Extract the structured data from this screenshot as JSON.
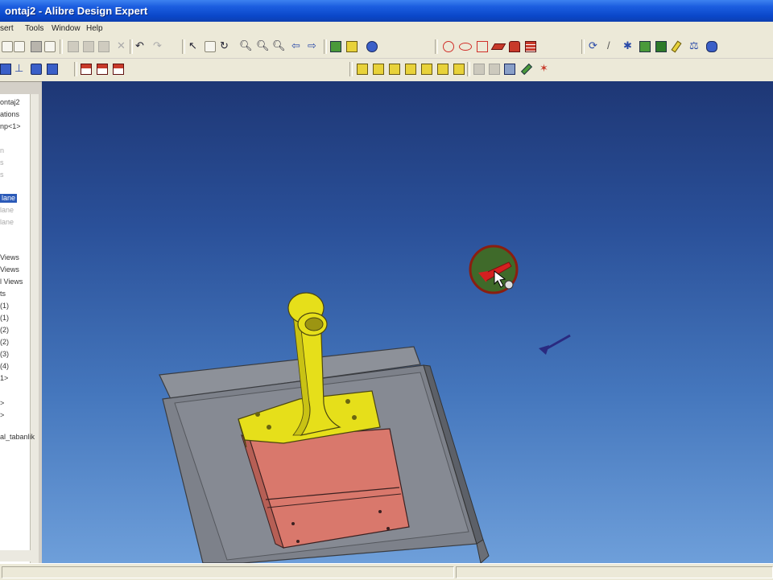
{
  "window": {
    "title": "ontaj2 - Alibre Design Expert"
  },
  "menu": {
    "items": [
      "sert",
      "Tools",
      "Window",
      "Help"
    ]
  },
  "tree": {
    "items": [
      {
        "label": "ontaj2",
        "style": "normal"
      },
      {
        "label": "ations",
        "style": "normal"
      },
      {
        "label": "np<1>",
        "style": "normal"
      },
      {
        "label": "n",
        "style": "faded"
      },
      {
        "label": "s",
        "style": "faded"
      },
      {
        "label": "s",
        "style": "faded"
      },
      {
        "label": "lane",
        "style": "sel"
      },
      {
        "label": "lane",
        "style": "faded"
      },
      {
        "label": "lane",
        "style": "faded"
      },
      {
        "label": "Views",
        "style": "normal"
      },
      {
        "label": "Views",
        "style": "normal"
      },
      {
        "label": "l Views",
        "style": "normal"
      },
      {
        "label": "ts",
        "style": "normal"
      },
      {
        "label": "(1)",
        "style": "normal"
      },
      {
        "label": "(1)",
        "style": "normal"
      },
      {
        "label": "(2)",
        "style": "normal"
      },
      {
        "label": "(2)",
        "style": "normal"
      },
      {
        "label": "(3)",
        "style": "normal"
      },
      {
        "label": "(4)",
        "style": "normal"
      },
      {
        "label": "1>",
        "style": "normal"
      },
      {
        "label": ">",
        "style": "normal"
      },
      {
        "label": ">",
        "style": "normal"
      },
      {
        "label": "al_tabanlik",
        "style": "normal"
      }
    ]
  },
  "icons": {
    "toolbar1": [
      "open-icon",
      "save-icon",
      "print-icon",
      "print-preview-icon",
      "cut-icon",
      "copy-icon",
      "paste-icon",
      "delete-icon",
      "undo-icon",
      "redo-icon",
      "select-icon",
      "select-box-icon",
      "rotate-icon",
      "zoom-icon",
      "zoom-window-icon",
      "zoom-fit-icon",
      "previous-view-icon",
      "next-view-icon",
      "part-icon",
      "assembly-icon",
      "render-icon",
      "point-icon",
      "ellipse-icon",
      "rectangle-icon",
      "pencil-icon",
      "eraser-icon",
      "stack-icon",
      "view-orient-icon",
      "line-icon",
      "constraint-icon",
      "material-icon",
      "cube-icon",
      "measure-icon",
      "balance-icon",
      "explode-icon"
    ],
    "toolbar2": [
      "assembly-tree-icon",
      "mate-icon",
      "align-icon",
      "drawing-icon",
      "drawing-sheet-icon",
      "bom-icon"
    ],
    "views": [
      "iso-view-1-icon",
      "iso-view-2-icon",
      "iso-view-3-icon",
      "iso-view-4-icon",
      "iso-view-5-icon",
      "iso-view-6-icon",
      "iso-view-7-icon",
      "grid-icon",
      "section-icon",
      "render-mode-icon",
      "measure-tool-icon",
      "explode-tool-icon"
    ]
  },
  "colors": {
    "bracket_yellow": "#e6df1a",
    "block_salmon": "#d9786c",
    "plate_gray": "#8a8e96",
    "triad_green": "#3f6a2a",
    "triad_red": "#d42020"
  }
}
